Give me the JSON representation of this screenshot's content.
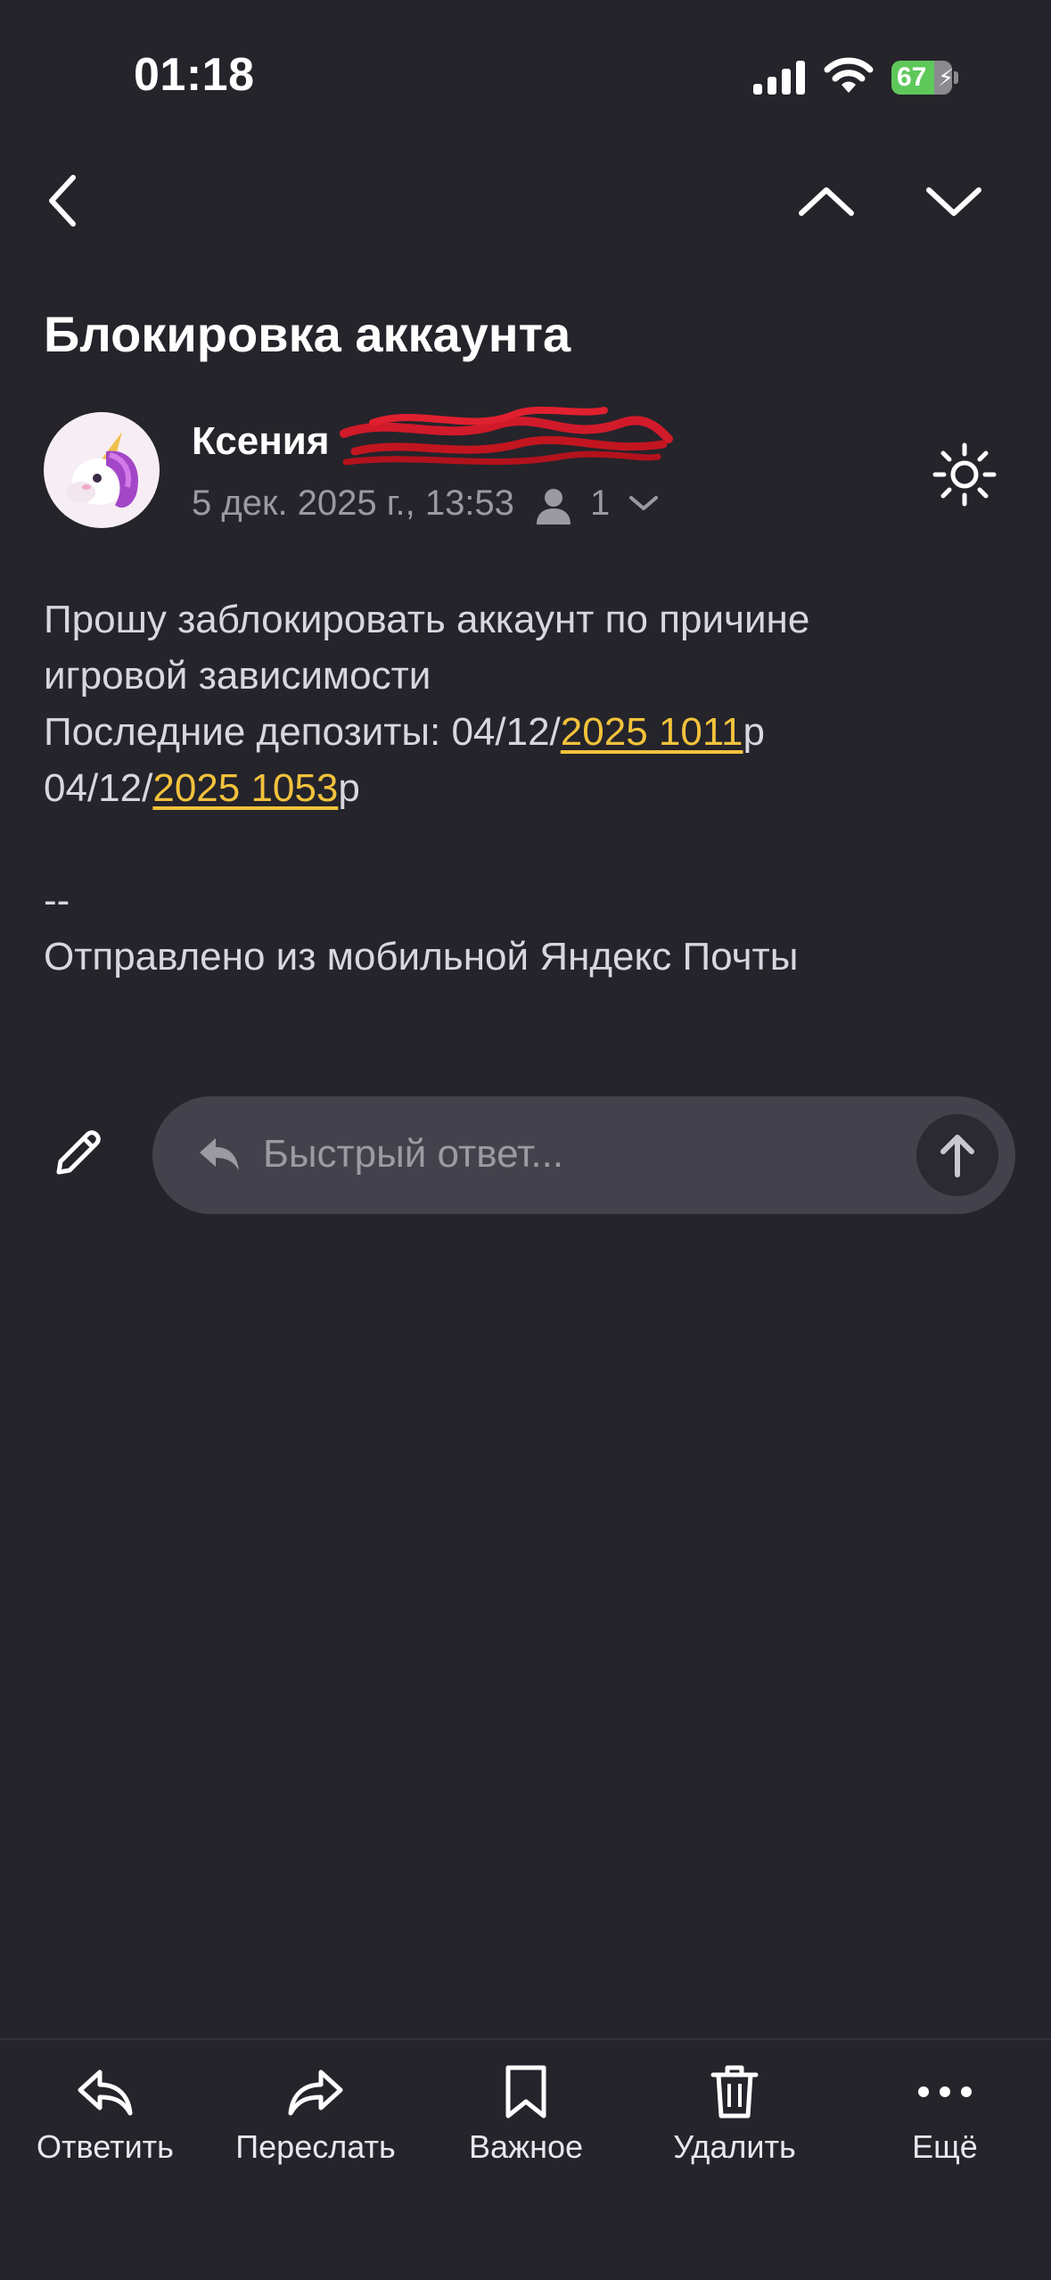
{
  "status_bar": {
    "time": "01:18",
    "battery_percent": "67"
  },
  "nav": {
    "back_icon": "chevron-left-icon",
    "prev_icon": "chevron-up-icon",
    "next_icon": "chevron-down-icon"
  },
  "message": {
    "subject": "Блокировка аккаунта",
    "sender": {
      "name": "Ксения"
    },
    "date": "5 дек. 2025 г., 13:53",
    "recipients_count": "1",
    "body": {
      "line1": "Прошу заблокировать аккаунт по причине",
      "line2": "игровой зависимости",
      "line3_prefix": "Последние депозиты: 04/12/",
      "line3_link": "2025 1011",
      "line3_suffix": "р",
      "line4_prefix": "04/12/",
      "line4_link": "2025 1053",
      "line4_suffix": "р",
      "separator": "--",
      "signature": "Отправлено из мобильной Яндекс Почты"
    }
  },
  "quick_reply": {
    "placeholder": "Быстрый ответ..."
  },
  "toolbar": {
    "reply": "Ответить",
    "forward": "Переслать",
    "important": "Важное",
    "delete": "Удалить",
    "more": "Ещё"
  },
  "colors": {
    "background": "#25242b",
    "link": "#f3c23c",
    "reply_box": "#43424c",
    "battery": "#5fc85a"
  }
}
